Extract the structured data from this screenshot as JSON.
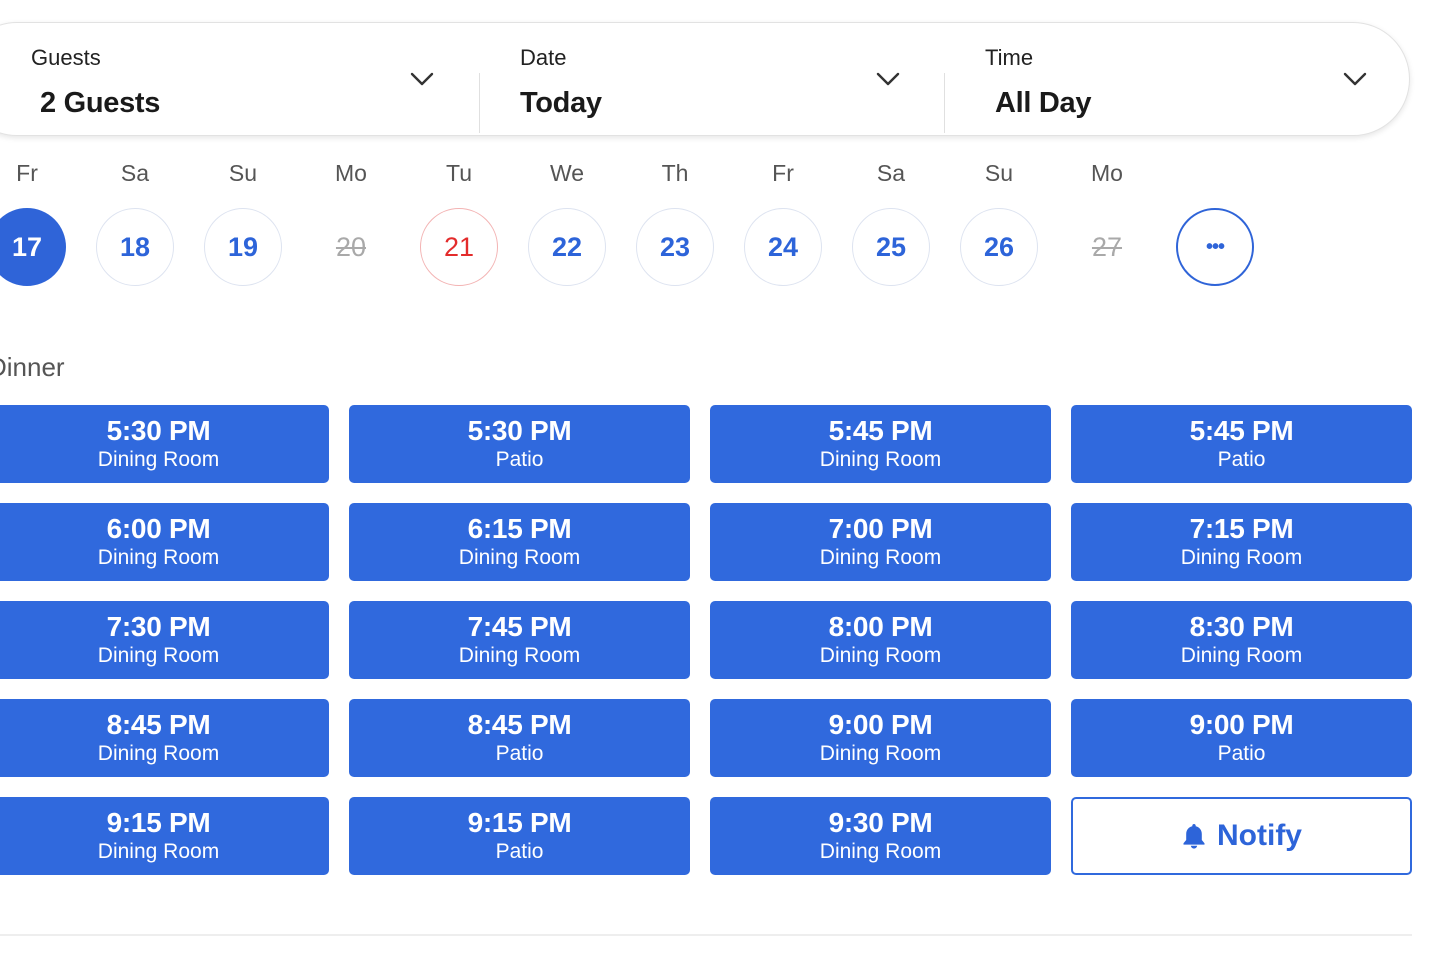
{
  "filters": {
    "guests": {
      "label": "Guests",
      "value": "2 Guests"
    },
    "date": {
      "label": "Date",
      "value": "Today"
    },
    "time": {
      "label": "Time",
      "value": "All Day"
    }
  },
  "days": [
    {
      "dow": "Fr",
      "num": "17",
      "state": "selected"
    },
    {
      "dow": "Sa",
      "num": "18",
      "state": "available"
    },
    {
      "dow": "Su",
      "num": "19",
      "state": "available"
    },
    {
      "dow": "Mo",
      "num": "20",
      "state": "disabled"
    },
    {
      "dow": "Tu",
      "num": "21",
      "state": "today"
    },
    {
      "dow": "We",
      "num": "22",
      "state": "available"
    },
    {
      "dow": "Th",
      "num": "23",
      "state": "available"
    },
    {
      "dow": "Fr",
      "num": "24",
      "state": "available"
    },
    {
      "dow": "Sa",
      "num": "25",
      "state": "available"
    },
    {
      "dow": "Su",
      "num": "26",
      "state": "available"
    },
    {
      "dow": "Mo",
      "num": "27",
      "state": "disabled"
    }
  ],
  "more_days_label": "•••",
  "section": {
    "title": "Dinner"
  },
  "slots": [
    {
      "time": "5:30 PM",
      "room": "Dining Room"
    },
    {
      "time": "5:30 PM",
      "room": "Patio"
    },
    {
      "time": "5:45 PM",
      "room": "Dining Room"
    },
    {
      "time": "5:45 PM",
      "room": "Patio"
    },
    {
      "time": "6:00 PM",
      "room": "Dining Room"
    },
    {
      "time": "6:15 PM",
      "room": "Dining Room"
    },
    {
      "time": "7:00 PM",
      "room": "Dining Room"
    },
    {
      "time": "7:15 PM",
      "room": "Dining Room"
    },
    {
      "time": "7:30 PM",
      "room": "Dining Room"
    },
    {
      "time": "7:45 PM",
      "room": "Dining Room"
    },
    {
      "time": "8:00 PM",
      "room": "Dining Room"
    },
    {
      "time": "8:30 PM",
      "room": "Dining Room"
    },
    {
      "time": "8:45 PM",
      "room": "Dining Room"
    },
    {
      "time": "8:45 PM",
      "room": "Patio"
    },
    {
      "time": "9:00 PM",
      "room": "Dining Room"
    },
    {
      "time": "9:00 PM",
      "room": "Patio"
    },
    {
      "time": "9:15 PM",
      "room": "Dining Room"
    },
    {
      "time": "9:15 PM",
      "room": "Patio"
    },
    {
      "time": "9:30 PM",
      "room": "Dining Room"
    }
  ],
  "notify": {
    "label": "Notify",
    "icon": "bell-icon"
  },
  "colors": {
    "accent": "#3069dd",
    "today": "#e32b2b",
    "disabled": "#a9a9a9"
  }
}
